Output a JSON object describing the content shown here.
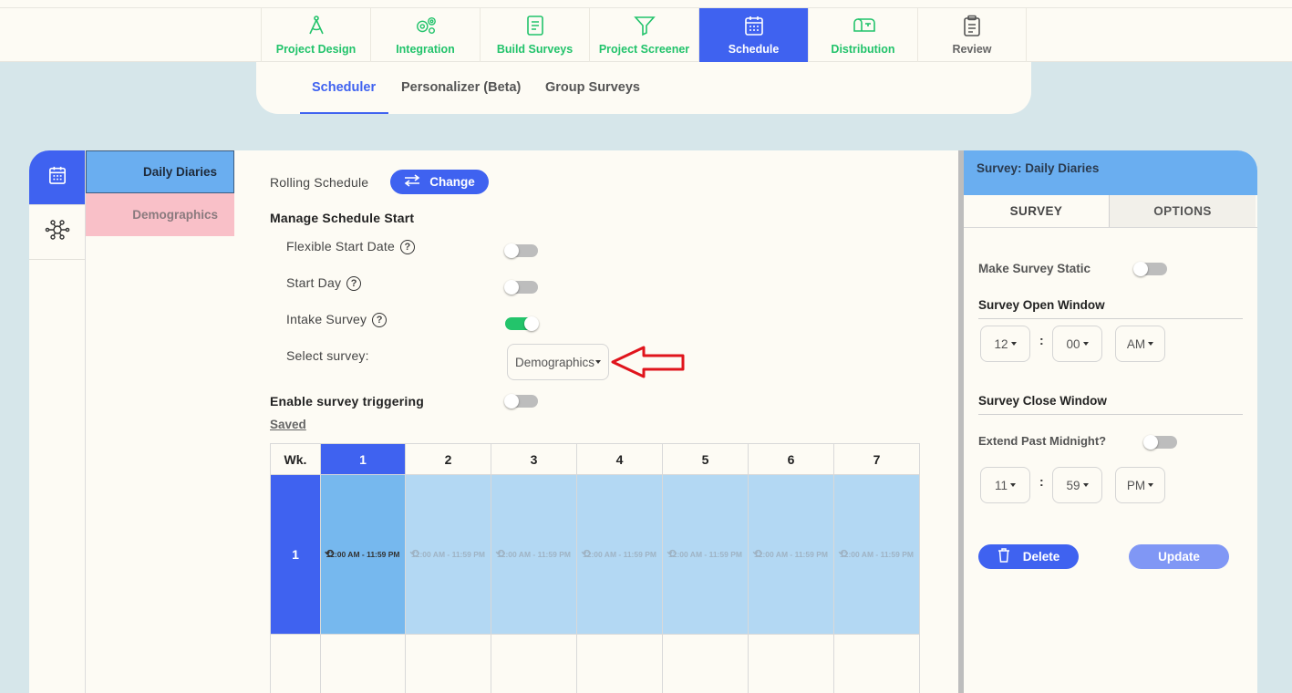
{
  "nav": {
    "tabs": [
      {
        "label": "Project Design",
        "icon": "compass-icon"
      },
      {
        "label": "Integration",
        "icon": "gears-icon"
      },
      {
        "label": "Build Surveys",
        "icon": "document-icon"
      },
      {
        "label": "Project Screener",
        "icon": "filter-icon"
      },
      {
        "label": "Schedule",
        "icon": "calendar-icon",
        "active": true
      },
      {
        "label": "Distribution",
        "icon": "mailbox-icon"
      },
      {
        "label": "Review",
        "icon": "clipboard-icon"
      }
    ]
  },
  "subnav": {
    "tabs": [
      "Scheduler",
      "Personalizer (Beta)",
      "Group Surveys"
    ],
    "active": "Scheduler"
  },
  "surveys": {
    "items": [
      "Daily Diaries",
      "Demographics"
    ],
    "active": "Daily Diaries"
  },
  "schedule": {
    "rolling_label": "Rolling Schedule",
    "change_label": "Change",
    "manage_label": "Manage Schedule Start",
    "flexible_label": "Flexible Start Date",
    "flexible_on": false,
    "start_day_label": "Start Day",
    "start_day_on": false,
    "intake_label": "Intake Survey",
    "intake_on": true,
    "select_label": "Select survey:",
    "select_value": "Demographics",
    "trigger_label": "Enable survey triggering",
    "trigger_on": false,
    "saved_label": "Saved",
    "help_glyph": "?"
  },
  "grid": {
    "week_header": "Wk.",
    "days": [
      "1",
      "2",
      "3",
      "4",
      "5",
      "6",
      "7"
    ],
    "active_day": "1",
    "weeks": [
      "1"
    ],
    "slot_text": "12:00 AM - 11:59 PM",
    "repeat_glyph": "⟲"
  },
  "panel": {
    "title": "Survey: Daily Diaries",
    "tabs": [
      "SURVEY",
      "OPTIONS"
    ],
    "static_label": "Make Survey Static",
    "static_on": false,
    "open_label": "Survey Open Window",
    "open": {
      "hour": "12",
      "minute": "00",
      "ampm": "AM"
    },
    "close_label": "Survey Close Window",
    "extend_label": "Extend Past Midnight?",
    "extend_on": false,
    "close": {
      "hour": "11",
      "minute": "59",
      "ampm": "PM"
    },
    "colon": ":",
    "delete_label": "Delete",
    "update_label": "Update"
  },
  "colors": {
    "accent": "#3f62f0",
    "green": "#22c36b",
    "selected_survey": "#6aaef0",
    "pink": "#f9c0c8",
    "slot": "#b3d8f3",
    "arrow": "#e0141c"
  }
}
